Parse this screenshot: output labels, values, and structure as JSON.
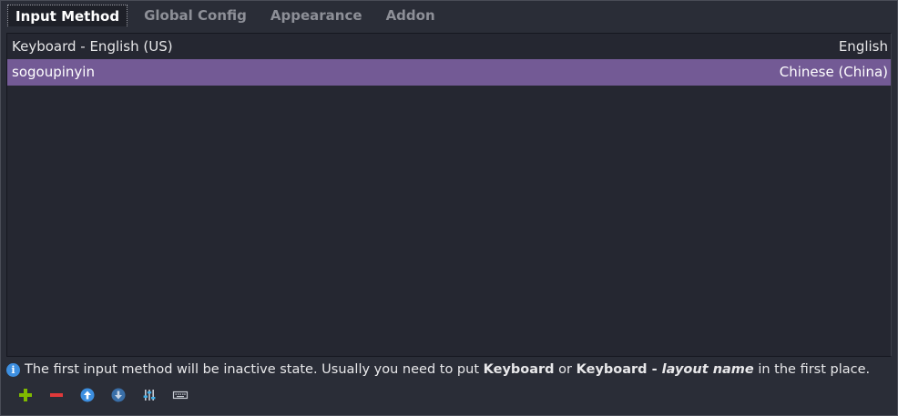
{
  "tabs": [
    {
      "label": "Input Method",
      "active": true
    },
    {
      "label": "Global Config",
      "active": false
    },
    {
      "label": "Appearance",
      "active": false
    },
    {
      "label": "Addon",
      "active": false
    }
  ],
  "list": {
    "rows": [
      {
        "name": "Keyboard - English (US)",
        "language": "English",
        "selected": false
      },
      {
        "name": "sogoupinyin",
        "language": "Chinese (China)",
        "selected": true
      }
    ]
  },
  "info": {
    "icon": "info-icon",
    "text_1": "The first input method will be inactive state. Usually you need to put ",
    "bold_1": "Keyboard",
    "text_2": " or ",
    "bold_2": "Keyboard - ",
    "italic": "layout name",
    "text_3": " in the first place."
  },
  "toolbar": {
    "buttons": [
      {
        "name": "add-button",
        "icon": "plus-icon"
      },
      {
        "name": "remove-button",
        "icon": "minus-icon"
      },
      {
        "name": "move-up-button",
        "icon": "arrow-up-icon"
      },
      {
        "name": "move-down-button",
        "icon": "arrow-down-icon"
      },
      {
        "name": "configure-button",
        "icon": "settings-sliders-icon"
      },
      {
        "name": "keyboard-layout-button",
        "icon": "keyboard-icon"
      }
    ]
  },
  "colors": {
    "background": "#2a2d37",
    "list_background": "#252731",
    "selection": "#735a95",
    "accent_green": "#7fba00",
    "accent_red": "#e0393a",
    "accent_blue": "#3d8fe0"
  }
}
